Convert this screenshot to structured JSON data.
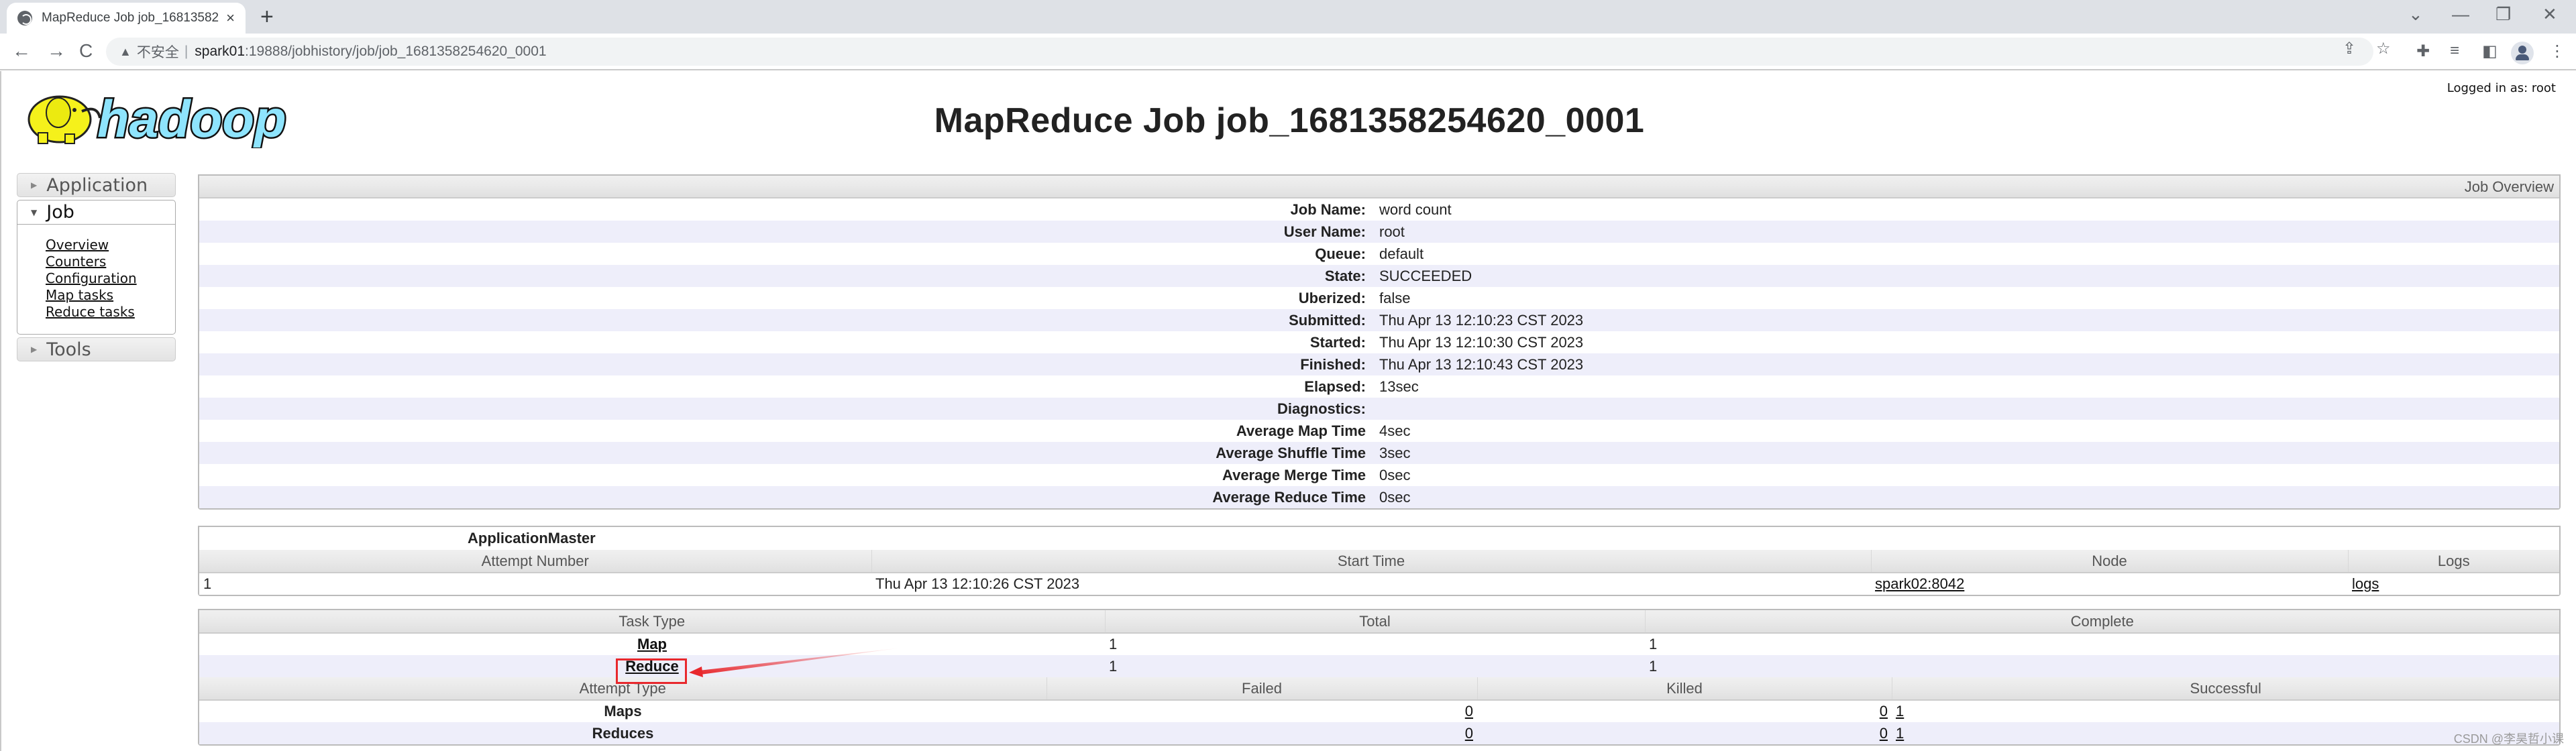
{
  "browser": {
    "tab_title": "MapReduce Job job_16813582",
    "tab_close": "×",
    "new_tab": "+",
    "window_controls": [
      "⌄",
      "—",
      "❐",
      "✕"
    ],
    "nav": {
      "back": "←",
      "forward": "→",
      "reload": "C"
    },
    "security_warning": "▲",
    "security_label": "不安全",
    "url_host": "spark01",
    "url_path": ":19888/jobhistory/job/job_1681358254620_0001",
    "icons": [
      "share-icon",
      "star-icon",
      "extensions-icon",
      "media-icon",
      "sidepanel-icon",
      "profile-icon",
      "menu-icon"
    ]
  },
  "page": {
    "logged_in": "Logged in as: root",
    "title": "MapReduce Job job_1681358254620_0001",
    "logo_text": "hadoop"
  },
  "sidebar": {
    "sections": [
      {
        "label": "Application",
        "expanded": false
      },
      {
        "label": "Job",
        "expanded": true,
        "links": [
          "Overview",
          "Counters",
          "Configuration",
          "Map tasks",
          "Reduce tasks"
        ]
      },
      {
        "label": "Tools",
        "expanded": false
      }
    ]
  },
  "overview": {
    "header": "Job Overview",
    "rows": [
      {
        "label": "Job Name:",
        "value": "word count"
      },
      {
        "label": "User Name:",
        "value": "root"
      },
      {
        "label": "Queue:",
        "value": "default"
      },
      {
        "label": "State:",
        "value": "SUCCEEDED"
      },
      {
        "label": "Uberized:",
        "value": "false"
      },
      {
        "label": "Submitted:",
        "value": "Thu Apr 13 12:10:23 CST 2023"
      },
      {
        "label": "Started:",
        "value": "Thu Apr 13 12:10:30 CST 2023"
      },
      {
        "label": "Finished:",
        "value": "Thu Apr 13 12:10:43 CST 2023"
      },
      {
        "label": "Elapsed:",
        "value": "13sec"
      },
      {
        "label": "Diagnostics:",
        "value": ""
      },
      {
        "label": "Average Map Time",
        "value": "4sec"
      },
      {
        "label": "Average Shuffle Time",
        "value": "3sec"
      },
      {
        "label": "Average Merge Time",
        "value": "0sec"
      },
      {
        "label": "Average Reduce Time",
        "value": "0sec"
      }
    ]
  },
  "app_master": {
    "title": "ApplicationMaster",
    "columns": [
      "Attempt Number",
      "Start Time",
      "Node",
      "Logs"
    ],
    "rows": [
      {
        "attempt": "1",
        "start_time": "Thu Apr 13 12:10:26 CST 2023",
        "node": "spark02:8042",
        "logs": "logs"
      }
    ]
  },
  "tasks": {
    "columns": [
      "Task Type",
      "Total",
      "Complete"
    ],
    "rows": [
      {
        "type": "Map",
        "total": "1",
        "complete": "1"
      },
      {
        "type": "Reduce",
        "total": "1",
        "complete": "1"
      }
    ]
  },
  "attempts": {
    "columns": [
      "Attempt Type",
      "Failed",
      "Killed",
      "Successful"
    ],
    "rows": [
      {
        "type": "Maps",
        "failed": "0",
        "killed": "0",
        "successful": "1"
      },
      {
        "type": "Reduces",
        "failed": "0",
        "killed": "0",
        "successful": "1"
      }
    ]
  },
  "annotation": {
    "highlight_color": "#e8282d",
    "target": "Reduce"
  },
  "watermark": "CSDN @李昊哲小课"
}
